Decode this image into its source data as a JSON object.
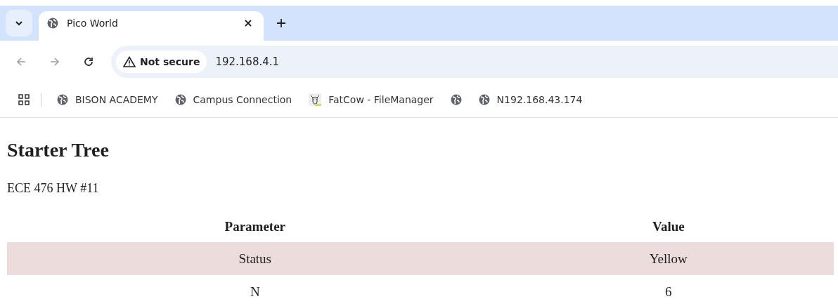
{
  "browser": {
    "tab": {
      "title": "Pico World",
      "selected": true
    },
    "security_chip": "Not secure",
    "address": "192.168.4.1",
    "bookmarks": [
      {
        "kind": "globe",
        "label": "BISON ACADEMY"
      },
      {
        "kind": "globe",
        "label": "Campus Connection"
      },
      {
        "kind": "cow",
        "label": "FatCow - FileManager"
      },
      {
        "kind": "globe"
      },
      {
        "kind": "globe",
        "label": "N192.168.43.174"
      }
    ]
  },
  "page": {
    "heading": "Starter Tree",
    "subtitle": "ECE 476 HW #11",
    "table": {
      "columns": [
        "Parameter",
        "Value"
      ],
      "rows": [
        [
          "Status",
          "Yellow"
        ],
        [
          "N",
          "6"
        ]
      ]
    }
  }
}
